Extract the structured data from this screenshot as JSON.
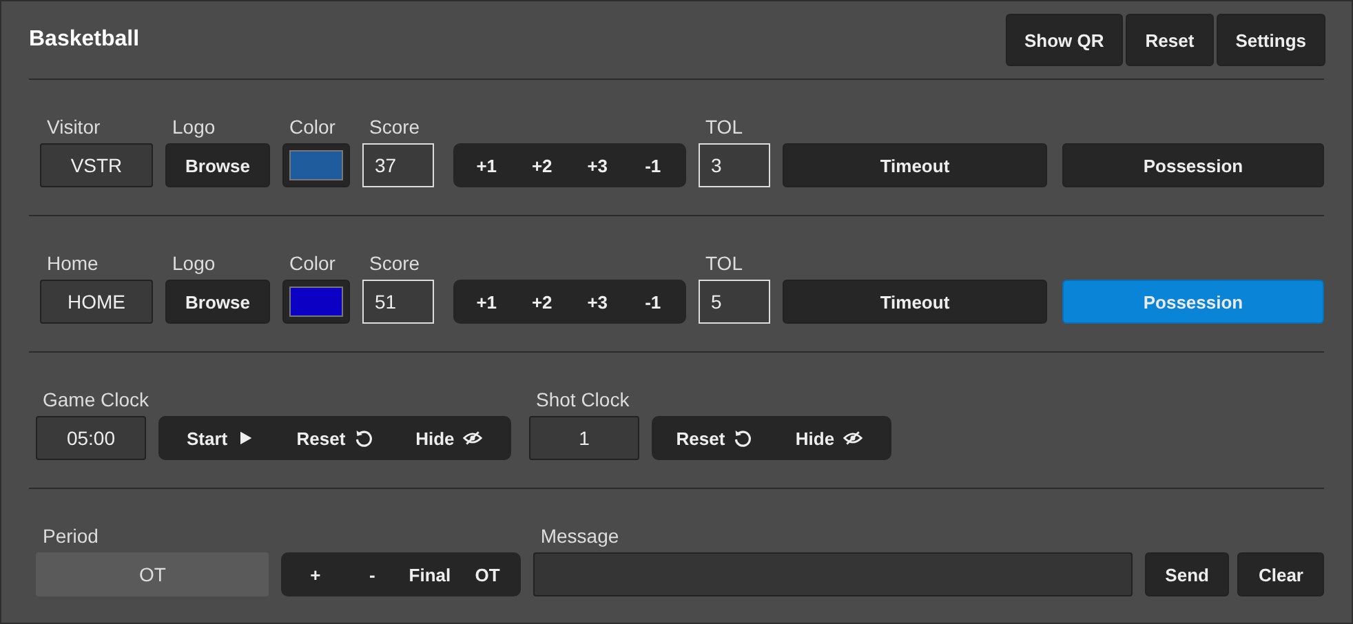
{
  "title": "Basketball",
  "header_buttons": [
    "Show QR",
    "Reset",
    "Settings"
  ],
  "teams": [
    {
      "name_label": "Visitor",
      "name": "VSTR",
      "logo_label": "Logo",
      "logo_button": "Browse",
      "color_label": "Color",
      "color": "#1f5c9e",
      "score_label": "Score",
      "score": "37",
      "score_buttons": [
        "+1",
        "+2",
        "+3",
        "-1"
      ],
      "tol_label": "TOL",
      "tol": "3",
      "timeout_button": "Timeout",
      "possession_button": "Possession",
      "possession": false
    },
    {
      "name_label": "Home",
      "name": "HOME",
      "logo_label": "Logo",
      "logo_button": "Browse",
      "color_label": "Color",
      "color": "#0b00c4",
      "score_label": "Score",
      "score": "51",
      "score_buttons": [
        "+1",
        "+2",
        "+3",
        "-1"
      ],
      "tol_label": "TOL",
      "tol": "5",
      "timeout_button": "Timeout",
      "possession_button": "Possession",
      "possession": true
    }
  ],
  "game_clock": {
    "label": "Game Clock",
    "value": "05:00",
    "buttons": [
      {
        "label": "Start",
        "kind": "play"
      },
      {
        "label": "Reset",
        "kind": "reset"
      },
      {
        "label": "Hide",
        "kind": "hide"
      }
    ]
  },
  "shot_clock": {
    "label": "Shot Clock",
    "value": "1",
    "buttons": [
      {
        "label": "Reset",
        "kind": "reset"
      },
      {
        "label": "Hide",
        "kind": "hide"
      }
    ]
  },
  "period": {
    "label": "Period",
    "value": "OT",
    "buttons": [
      "+",
      "-",
      "Final",
      "OT"
    ]
  },
  "message": {
    "label": "Message",
    "buttons": [
      "Send",
      "Clear"
    ]
  }
}
